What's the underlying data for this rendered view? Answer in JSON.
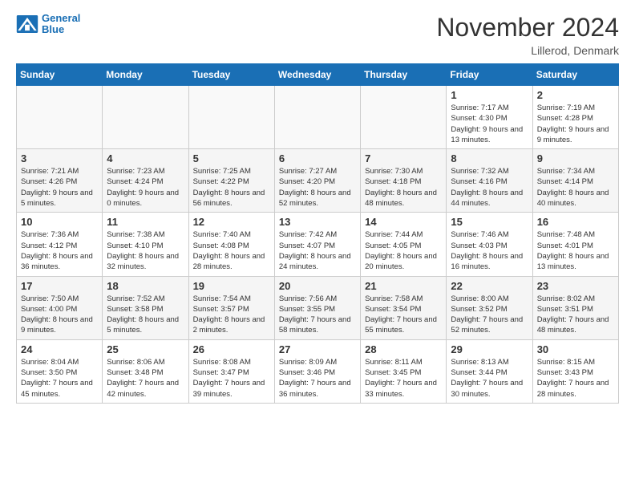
{
  "header": {
    "logo_line1": "General",
    "logo_line2": "Blue",
    "title": "November 2024",
    "location": "Lillerod, Denmark"
  },
  "weekdays": [
    "Sunday",
    "Monday",
    "Tuesday",
    "Wednesday",
    "Thursday",
    "Friday",
    "Saturday"
  ],
  "weeks": [
    [
      {
        "day": "",
        "info": ""
      },
      {
        "day": "",
        "info": ""
      },
      {
        "day": "",
        "info": ""
      },
      {
        "day": "",
        "info": ""
      },
      {
        "day": "",
        "info": ""
      },
      {
        "day": "1",
        "info": "Sunrise: 7:17 AM\nSunset: 4:30 PM\nDaylight: 9 hours and 13 minutes."
      },
      {
        "day": "2",
        "info": "Sunrise: 7:19 AM\nSunset: 4:28 PM\nDaylight: 9 hours and 9 minutes."
      }
    ],
    [
      {
        "day": "3",
        "info": "Sunrise: 7:21 AM\nSunset: 4:26 PM\nDaylight: 9 hours and 5 minutes."
      },
      {
        "day": "4",
        "info": "Sunrise: 7:23 AM\nSunset: 4:24 PM\nDaylight: 9 hours and 0 minutes."
      },
      {
        "day": "5",
        "info": "Sunrise: 7:25 AM\nSunset: 4:22 PM\nDaylight: 8 hours and 56 minutes."
      },
      {
        "day": "6",
        "info": "Sunrise: 7:27 AM\nSunset: 4:20 PM\nDaylight: 8 hours and 52 minutes."
      },
      {
        "day": "7",
        "info": "Sunrise: 7:30 AM\nSunset: 4:18 PM\nDaylight: 8 hours and 48 minutes."
      },
      {
        "day": "8",
        "info": "Sunrise: 7:32 AM\nSunset: 4:16 PM\nDaylight: 8 hours and 44 minutes."
      },
      {
        "day": "9",
        "info": "Sunrise: 7:34 AM\nSunset: 4:14 PM\nDaylight: 8 hours and 40 minutes."
      }
    ],
    [
      {
        "day": "10",
        "info": "Sunrise: 7:36 AM\nSunset: 4:12 PM\nDaylight: 8 hours and 36 minutes."
      },
      {
        "day": "11",
        "info": "Sunrise: 7:38 AM\nSunset: 4:10 PM\nDaylight: 8 hours and 32 minutes."
      },
      {
        "day": "12",
        "info": "Sunrise: 7:40 AM\nSunset: 4:08 PM\nDaylight: 8 hours and 28 minutes."
      },
      {
        "day": "13",
        "info": "Sunrise: 7:42 AM\nSunset: 4:07 PM\nDaylight: 8 hours and 24 minutes."
      },
      {
        "day": "14",
        "info": "Sunrise: 7:44 AM\nSunset: 4:05 PM\nDaylight: 8 hours and 20 minutes."
      },
      {
        "day": "15",
        "info": "Sunrise: 7:46 AM\nSunset: 4:03 PM\nDaylight: 8 hours and 16 minutes."
      },
      {
        "day": "16",
        "info": "Sunrise: 7:48 AM\nSunset: 4:01 PM\nDaylight: 8 hours and 13 minutes."
      }
    ],
    [
      {
        "day": "17",
        "info": "Sunrise: 7:50 AM\nSunset: 4:00 PM\nDaylight: 8 hours and 9 minutes."
      },
      {
        "day": "18",
        "info": "Sunrise: 7:52 AM\nSunset: 3:58 PM\nDaylight: 8 hours and 5 minutes."
      },
      {
        "day": "19",
        "info": "Sunrise: 7:54 AM\nSunset: 3:57 PM\nDaylight: 8 hours and 2 minutes."
      },
      {
        "day": "20",
        "info": "Sunrise: 7:56 AM\nSunset: 3:55 PM\nDaylight: 7 hours and 58 minutes."
      },
      {
        "day": "21",
        "info": "Sunrise: 7:58 AM\nSunset: 3:54 PM\nDaylight: 7 hours and 55 minutes."
      },
      {
        "day": "22",
        "info": "Sunrise: 8:00 AM\nSunset: 3:52 PM\nDaylight: 7 hours and 52 minutes."
      },
      {
        "day": "23",
        "info": "Sunrise: 8:02 AM\nSunset: 3:51 PM\nDaylight: 7 hours and 48 minutes."
      }
    ],
    [
      {
        "day": "24",
        "info": "Sunrise: 8:04 AM\nSunset: 3:50 PM\nDaylight: 7 hours and 45 minutes."
      },
      {
        "day": "25",
        "info": "Sunrise: 8:06 AM\nSunset: 3:48 PM\nDaylight: 7 hours and 42 minutes."
      },
      {
        "day": "26",
        "info": "Sunrise: 8:08 AM\nSunset: 3:47 PM\nDaylight: 7 hours and 39 minutes."
      },
      {
        "day": "27",
        "info": "Sunrise: 8:09 AM\nSunset: 3:46 PM\nDaylight: 7 hours and 36 minutes."
      },
      {
        "day": "28",
        "info": "Sunrise: 8:11 AM\nSunset: 3:45 PM\nDaylight: 7 hours and 33 minutes."
      },
      {
        "day": "29",
        "info": "Sunrise: 8:13 AM\nSunset: 3:44 PM\nDaylight: 7 hours and 30 minutes."
      },
      {
        "day": "30",
        "info": "Sunrise: 8:15 AM\nSunset: 3:43 PM\nDaylight: 7 hours and 28 minutes."
      }
    ]
  ]
}
